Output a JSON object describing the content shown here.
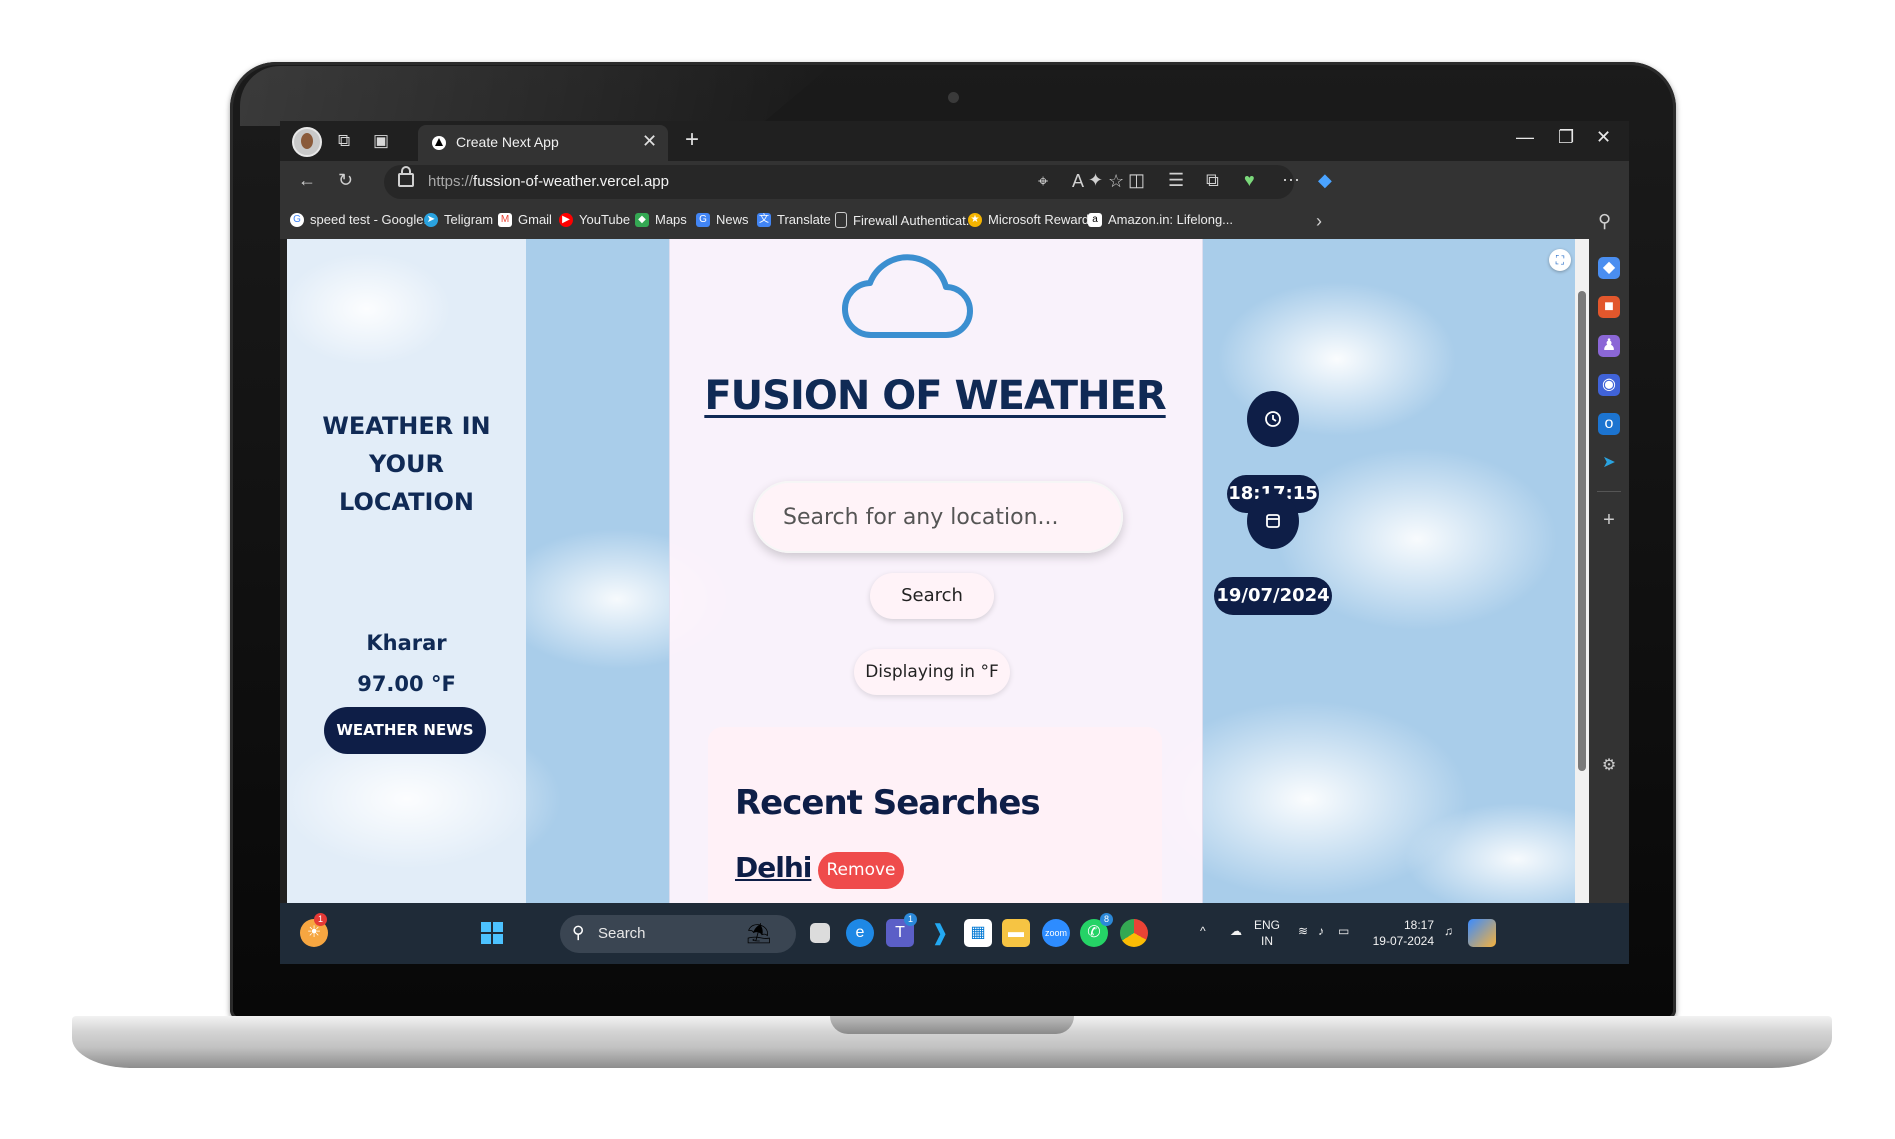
{
  "browser": {
    "tab_title": "Create Next App",
    "url_prefix": "https://",
    "url_host": "fussion-of-weather.vercel.app",
    "favorites": [
      {
        "label": "speed test - Google...",
        "icon": "google-icon",
        "color": "#ffffff"
      },
      {
        "label": "Teligram",
        "icon": "telegram-icon",
        "color": "#2aa3e0"
      },
      {
        "label": "Gmail",
        "icon": "gmail-icon",
        "color": "#ea4335"
      },
      {
        "label": "YouTube",
        "icon": "youtube-icon",
        "color": "#ff0000"
      },
      {
        "label": "Maps",
        "icon": "maps-icon",
        "color": "#34a853"
      },
      {
        "label": "News",
        "icon": "news-icon",
        "color": "#4285f4"
      },
      {
        "label": "Translate",
        "icon": "translate-icon",
        "color": "#4285f4"
      },
      {
        "label": "Firewall Authenticat...",
        "icon": "page-icon",
        "color": "#cccccc"
      },
      {
        "label": "Microsoft Rewards",
        "icon": "rewards-icon",
        "color": "#f4b400"
      },
      {
        "label": "Amazon.in: Lifelong...",
        "icon": "amazon-icon",
        "color": "#ffffff"
      }
    ]
  },
  "page": {
    "left_heading": "WEATHER IN YOUR LOCATION",
    "city": "Kharar",
    "temperature": "97.00 °F",
    "news_button": "WEATHER NEWS",
    "app_title": "FUSION OF WEATHER",
    "search_placeholder": "Search for any location...",
    "search_button": "Search",
    "unit_toggle": "Displaying in °F",
    "recent_heading": "Recent Searches",
    "recent_items": [
      {
        "city": "Delhi",
        "remove_label": "Remove"
      }
    ],
    "time": "18:17:15",
    "date": "19/07/2024"
  },
  "taskbar": {
    "search_label": "Search",
    "lang_line1": "ENG",
    "lang_line2": "IN",
    "clock_time": "18:17",
    "clock_date": "19-07-2024",
    "badges": {
      "teams": "1",
      "whatsapp": "8",
      "widgets": "1"
    }
  },
  "colors": {
    "navy": "#0e1e47",
    "sky": "#a9cdea",
    "remove_red": "#ef4b4b",
    "card_pink": "#fff1f7"
  }
}
